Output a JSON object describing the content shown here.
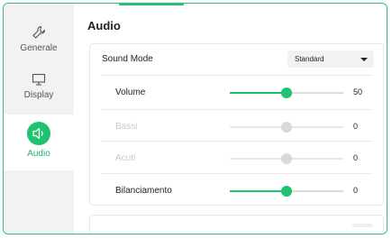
{
  "sidebar": {
    "items": [
      {
        "label": "Generale",
        "icon": "wrench-icon",
        "active": false
      },
      {
        "label": "Display",
        "icon": "monitor-icon",
        "active": false
      },
      {
        "label": "Audio",
        "icon": "speaker-icon",
        "active": true
      }
    ]
  },
  "main": {
    "title": "Audio",
    "sound_mode": {
      "label": "Sound Mode",
      "value": "Standard"
    },
    "sliders": [
      {
        "label": "Volume",
        "value": "50",
        "level": 0.5,
        "enabled": true
      },
      {
        "label": "Bassi",
        "value": "0",
        "level": 0.5,
        "enabled": false
      },
      {
        "label": "Acuti",
        "value": "0",
        "level": 0.5,
        "enabled": false
      },
      {
        "label": "Bilanciamento",
        "value": "0",
        "level": 0.5,
        "enabled": true
      }
    ]
  },
  "colors": {
    "accent": "#1fc36f",
    "disabled": "#d9d9d9"
  }
}
